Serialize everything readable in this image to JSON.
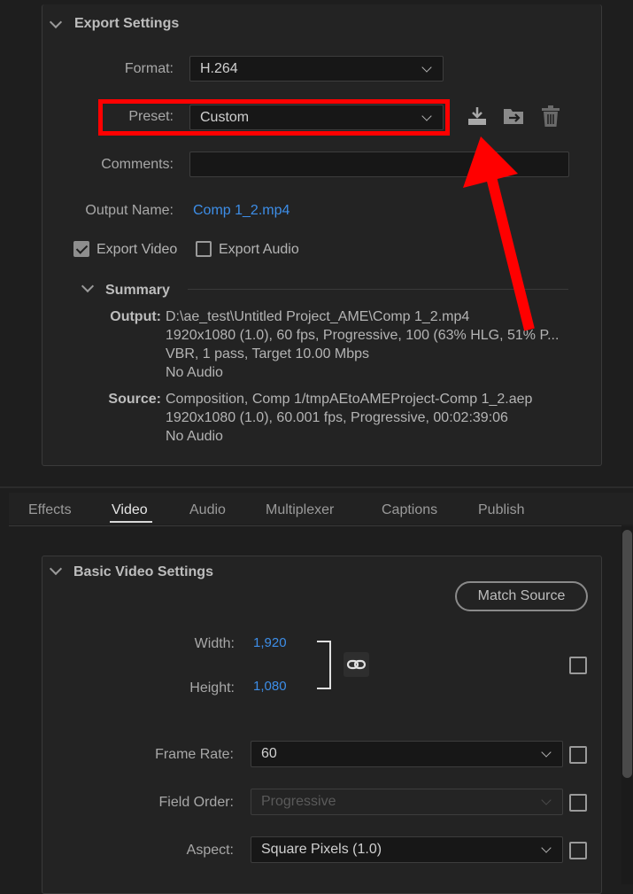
{
  "export_settings": {
    "title": "Export Settings",
    "format_label": "Format:",
    "format_value": "H.264",
    "preset_label": "Preset:",
    "preset_value": "Custom",
    "comments_label": "Comments:",
    "comments_value": "",
    "output_name_label": "Output Name:",
    "output_name_value": "Comp 1_2.mp4",
    "export_video_label": "Export Video",
    "export_video_checked": true,
    "export_audio_label": "Export Audio",
    "export_audio_checked": false,
    "icons": [
      "save-preset-icon",
      "import-preset-icon",
      "delete-preset-icon"
    ]
  },
  "summary": {
    "title": "Summary",
    "output_key": "Output:",
    "output_lines": [
      "D:\\ae_test\\Untitled Project_AME\\Comp 1_2.mp4",
      "1920x1080 (1.0), 60 fps, Progressive, 100 (63% HLG, 51% P...",
      "VBR, 1 pass, Target 10.00 Mbps",
      "No Audio"
    ],
    "source_key": "Source:",
    "source_lines": [
      "Composition, Comp 1/tmpAEtoAMEProject-Comp 1_2.aep",
      "1920x1080 (1.0), 60.001 fps, Progressive, 00:02:39:06",
      "No Audio"
    ]
  },
  "tabs": [
    "Effects",
    "Video",
    "Audio",
    "Multiplexer",
    "Captions",
    "Publish"
  ],
  "active_tab": "Video",
  "basic_video": {
    "title": "Basic Video Settings",
    "match_source_label": "Match Source",
    "width_label": "Width:",
    "width_value": "1,920",
    "height_label": "Height:",
    "height_value": "1,080",
    "frame_rate_label": "Frame Rate:",
    "frame_rate_value": "60",
    "field_order_label": "Field Order:",
    "field_order_value": "Progressive",
    "aspect_label": "Aspect:",
    "aspect_value": "Square Pixels (1.0)"
  },
  "colors": {
    "accent_link": "#3d8ee8",
    "annotation_red": "#ff0000",
    "background": "#1e1e1e"
  }
}
